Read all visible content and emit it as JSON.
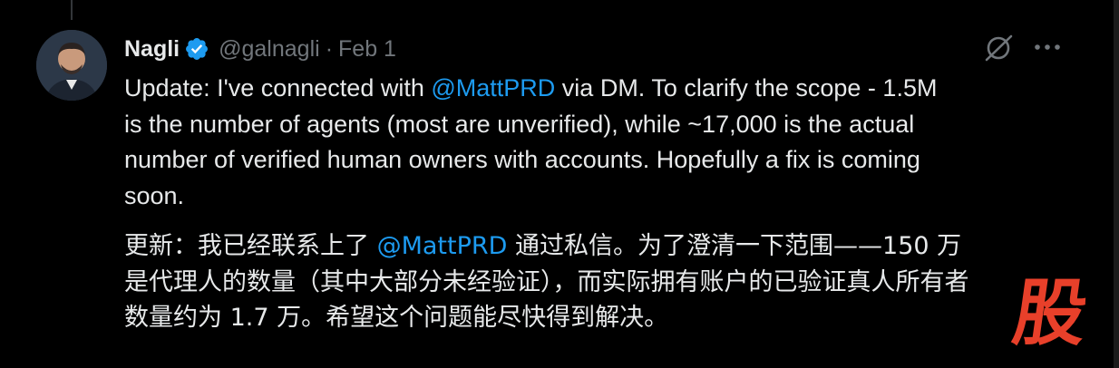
{
  "tweet": {
    "author_name": "Nagli",
    "handle": "@galnagli",
    "separator": "·",
    "date": "Feb 1",
    "en_prefix": "Update: I've connected with ",
    "en_mention": "@MattPRD",
    "en_suffix": " via DM. To clarify the scope - 1.5M\nis the number of agents (most are unverified), while ~17,000 is the actual\nnumber of verified human owners with accounts. Hopefully a fix is coming\nsoon.",
    "zh_prefix": "更新：我已经联系上了 ",
    "zh_mention": "@MattPRD",
    "zh_suffix": " 通过私信。为了澄清一下范围——150 万\n是代理人的数量（其中大部分未经验证），而实际拥有账户的已验证真人所有者\n数量约为 1.7 万。希望这个问题能尽快得到解决。"
  },
  "watermark_text": "股",
  "icons": {
    "verified": "verified-badge-icon",
    "grok": "grok-icon",
    "more": "more-options-icon"
  },
  "colors": {
    "background": "#000000",
    "text": "#e7e9ea",
    "muted": "#71767b",
    "link": "#1d9bf0",
    "verified": "#1d9bf0",
    "watermark": "#e8402a"
  }
}
